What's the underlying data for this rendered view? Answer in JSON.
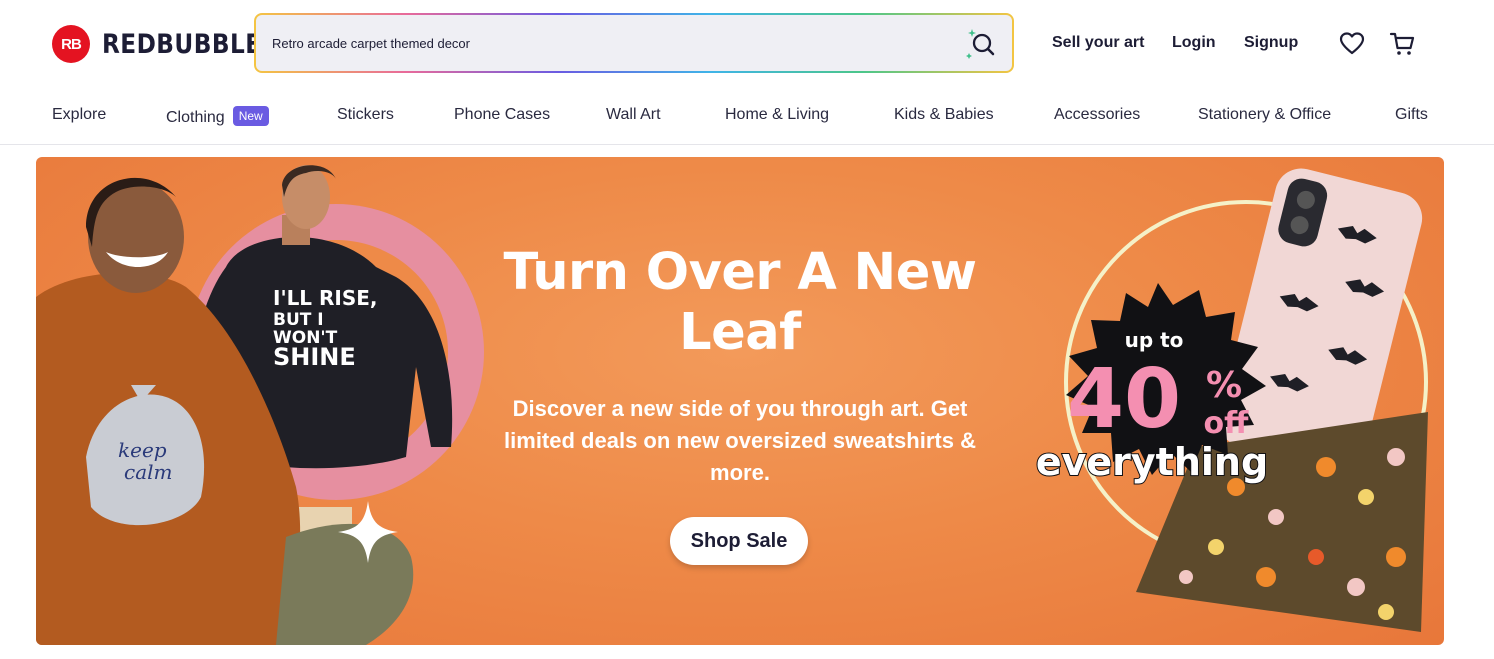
{
  "brand": {
    "logo_mark": "RB",
    "name": "REDBUBBLE"
  },
  "search": {
    "value": "Retro arcade carpet themed decor",
    "icon": "search-sparkle-icon"
  },
  "header_links": {
    "sell": "Sell your art",
    "login": "Login",
    "signup": "Signup"
  },
  "header_icons": {
    "wishlist": "heart-icon",
    "cart": "cart-icon"
  },
  "nav": {
    "explore": "Explore",
    "clothing": "Clothing",
    "clothing_badge": "New",
    "stickers": "Stickers",
    "phone_cases": "Phone Cases",
    "wall_art": "Wall Art",
    "home_living": "Home & Living",
    "kids_babies": "Kids & Babies",
    "accessories": "Accessories",
    "stationery_office": "Stationery & Office",
    "gifts": "Gifts"
  },
  "banner": {
    "headline": "Turn Over A New Leaf",
    "subhead": "Discover a new side of you through art. Get limited deals on new oversized sweatshirts & more.",
    "cta": "Shop Sale",
    "sweatshirt_print": [
      "I'LL RISE,",
      "BUT I",
      "WON'T",
      "SHINE"
    ],
    "hoodie_print": [
      "keep",
      "calm"
    ],
    "promo": {
      "line1": "up to",
      "percent": "40",
      "percent_sign": "%",
      "off": "off",
      "line3": "everything"
    }
  },
  "colors": {
    "brand_red": "#e41321",
    "accent_purple": "#6a5be2",
    "banner_orange": "#ee8a48",
    "promo_pink": "#f48fb1",
    "text_navy": "#1d1d35"
  }
}
